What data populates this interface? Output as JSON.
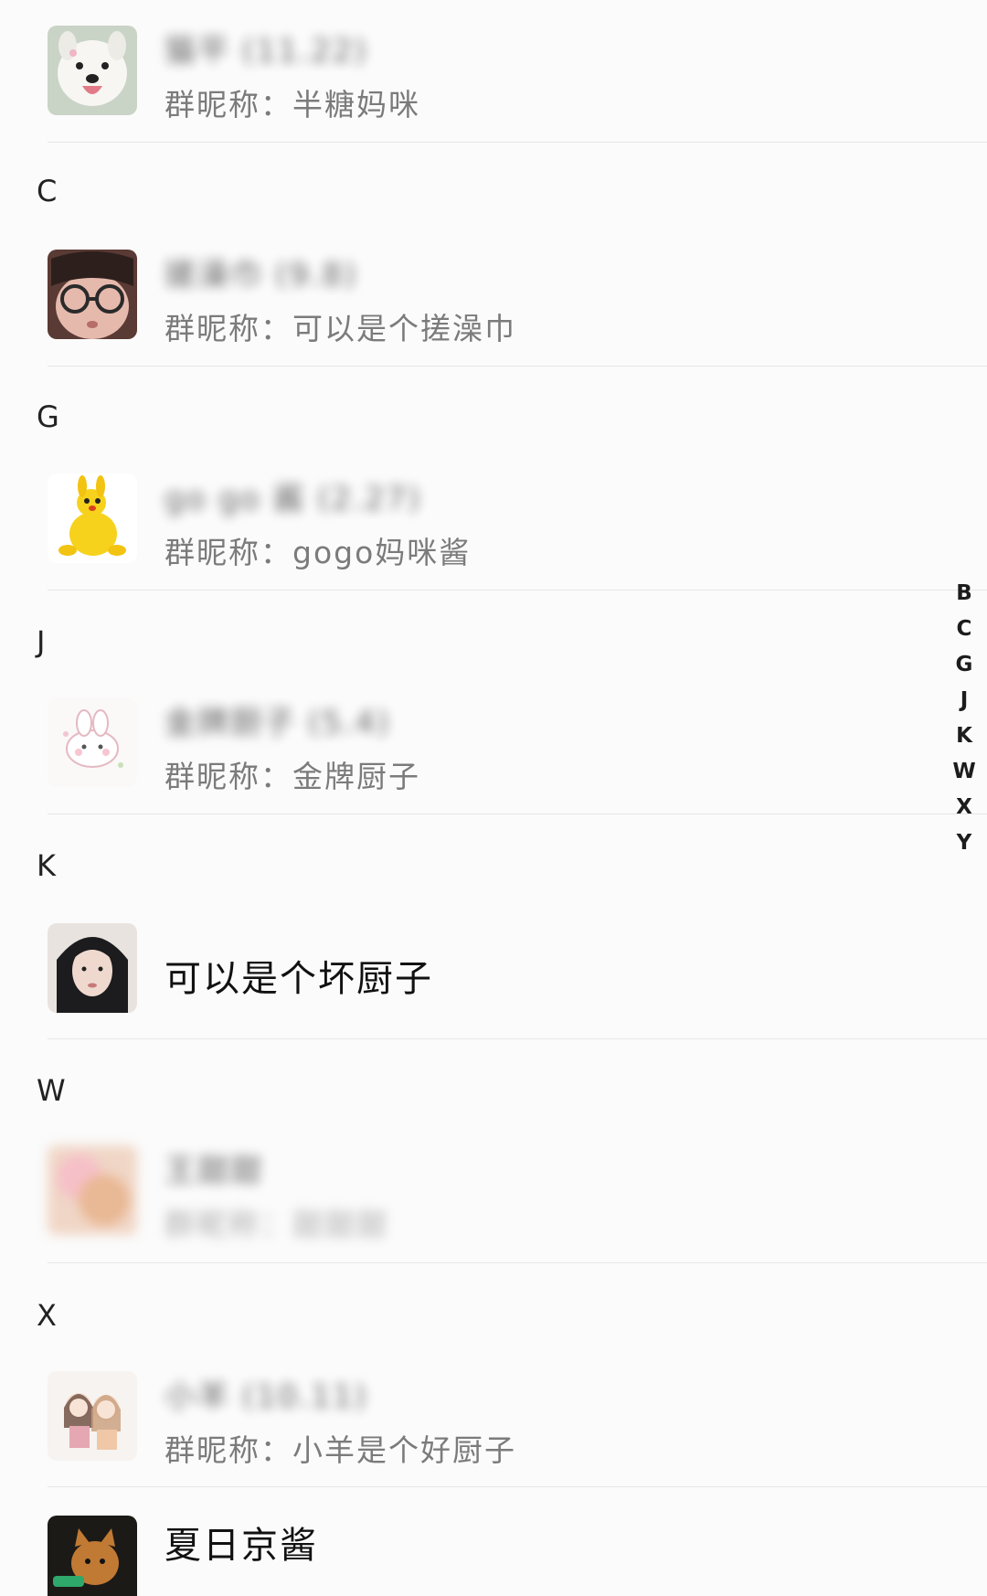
{
  "nickname_prefix": "群昵称：",
  "sections": [
    {
      "letter": ""
    },
    {
      "letter": "C"
    },
    {
      "letter": "G"
    },
    {
      "letter": "J"
    },
    {
      "letter": "K"
    },
    {
      "letter": "W"
    },
    {
      "letter": "X"
    }
  ],
  "contacts": [
    {
      "name": "猫平 (11.22)",
      "nickname": "半糖妈咪",
      "avatar": "samoyed-dog-avatar"
    },
    {
      "name": "搓澡巾 (9.8)",
      "nickname": "可以是个搓澡巾",
      "avatar": "kid-with-glasses-avatar"
    },
    {
      "name": "go go 酱 (2.27)",
      "nickname": "gogo妈咪酱",
      "avatar": "yellow-kangaroo-toy-avatar"
    },
    {
      "name": "金牌厨子 (5.4)",
      "nickname": "金牌厨子",
      "avatar": "cute-bunny-sticker-avatar"
    },
    {
      "name": "可以是个坏厨子",
      "nickname": "",
      "avatar": "woman-selfie-avatar"
    },
    {
      "name": "王甜甜",
      "nickname": "甜甜甜",
      "avatar": "blurred-avatar"
    },
    {
      "name": "小羊 (10.11)",
      "nickname": "小羊是个好厨子",
      "avatar": "two-girls-cartoon-avatar"
    },
    {
      "name": "夏日京酱",
      "nickname": "",
      "avatar": "kitten-avatar"
    }
  ],
  "index_letters": [
    "B",
    "C",
    "G",
    "J",
    "K",
    "W",
    "X",
    "Y"
  ]
}
